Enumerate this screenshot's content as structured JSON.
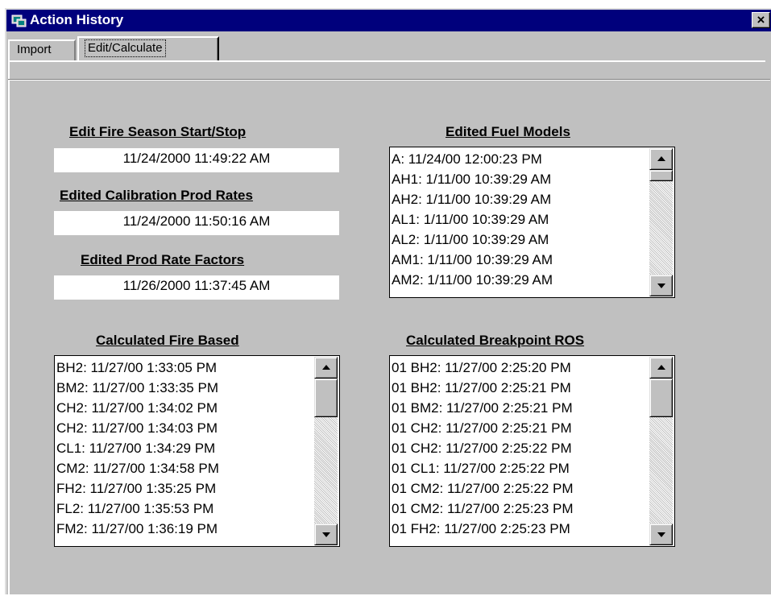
{
  "window": {
    "title": "Action History",
    "close_label": "×"
  },
  "tabs": [
    {
      "label": "Import",
      "selected": false
    },
    {
      "label": "Edit/Calculate",
      "selected": true
    }
  ],
  "fire_season": {
    "heading": "Edit Fire Season Start/Stop",
    "value": "11/24/2000 11:49:22 AM"
  },
  "calibration": {
    "heading": "Edited Calibration Prod Rates",
    "value": "11/24/2000 11:50:16 AM"
  },
  "prod_rate_factors": {
    "heading": "Edited Prod Rate Factors",
    "value": "11/26/2000 11:37:45 AM"
  },
  "fuel_models": {
    "heading": "Edited Fuel Models",
    "items": [
      "A: 11/24/00 12:00:23 PM",
      "AH1: 1/11/00 10:39:29 AM",
      "AH2: 1/11/00 10:39:29 AM",
      "AL1: 1/11/00 10:39:29 AM",
      "AL2: 1/11/00 10:39:29 AM",
      "AM1: 1/11/00 10:39:29 AM",
      "AM2: 1/11/00 10:39:29 AM"
    ]
  },
  "fire_based": {
    "heading": "Calculated Fire Based",
    "items": [
      "BH2: 11/27/00 1:33:05 PM",
      "BM2: 11/27/00 1:33:35 PM",
      "CH2: 11/27/00 1:34:02 PM",
      "CH2: 11/27/00 1:34:03 PM",
      "CL1: 11/27/00 1:34:29 PM",
      "CM2: 11/27/00 1:34:58 PM",
      "FH2: 11/27/00 1:35:25 PM",
      "FL2: 11/27/00 1:35:53 PM",
      "FM2: 11/27/00 1:36:19 PM"
    ]
  },
  "breakpoint_ros": {
    "heading": "Calculated Breakpoint ROS",
    "items": [
      "01 BH2: 11/27/00 2:25:20 PM",
      "01 BH2: 11/27/00 2:25:21 PM",
      "01 BM2: 11/27/00 2:25:21 PM",
      "01 CH2: 11/27/00 2:25:21 PM",
      "01 CH2: 11/27/00 2:25:22 PM",
      "01 CL1: 11/27/00 2:25:22 PM",
      "01 CM2: 11/27/00 2:25:22 PM",
      "01 CM2: 11/27/00 2:25:23 PM",
      "01 FH2: 11/27/00 2:25:23 PM"
    ]
  },
  "colors": {
    "titlebar": "#00007c",
    "face": "#c0c0c0",
    "field": "#ffffff"
  }
}
